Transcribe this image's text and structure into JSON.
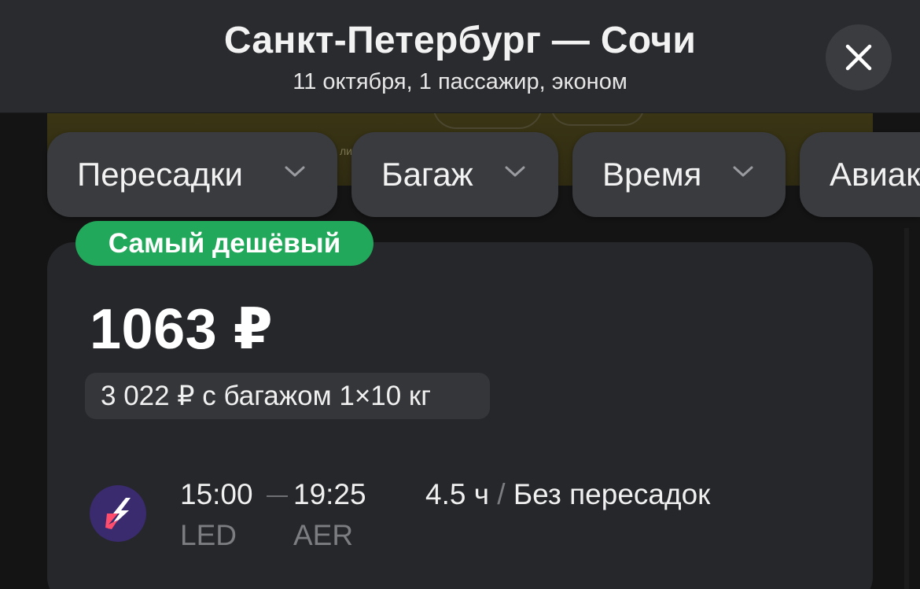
{
  "header": {
    "title": "Санкт-Петербург — Сочи",
    "subtitle": "11 октября, 1 пассажир, эконом",
    "close_icon": "close-icon"
  },
  "banner": {
    "partial_text": "ли"
  },
  "filters": {
    "chips": [
      {
        "label": "Пересадки",
        "icon": "chevron-down-icon"
      },
      {
        "label": "Багаж",
        "icon": "chevron-down-icon"
      },
      {
        "label": "Время",
        "icon": "chevron-down-icon"
      },
      {
        "label": "Авиак"
      }
    ]
  },
  "result": {
    "badge": "Самый дешёвый",
    "badge_color": "#21a85a",
    "price": "1063 ₽",
    "baggage_price": "3 022 ₽ с багажом 1×10 кг",
    "airline_logo_icon": "airline-logo-icon",
    "airline_logo_color": "#3a2a6e",
    "departure_time": "15:00",
    "arrival_time": "19:25",
    "departure_code": "LED",
    "arrival_code": "AER",
    "duration": "4.5 ч",
    "separator": "/",
    "stops": "Без пересадок"
  }
}
